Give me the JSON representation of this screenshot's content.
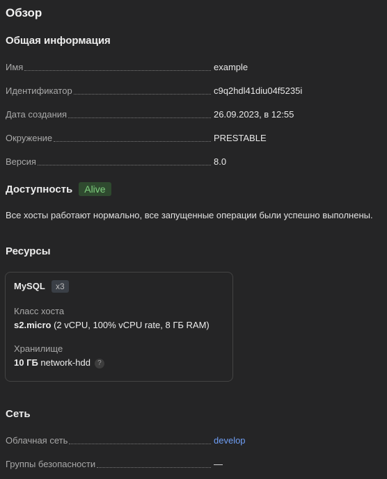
{
  "page": {
    "title": "Обзор"
  },
  "general": {
    "title": "Общая информация",
    "rows": [
      {
        "label": "Имя",
        "value": "example"
      },
      {
        "label": "Идентификатор",
        "value": "c9q2hdl41diu04f5235i"
      },
      {
        "label": "Дата создания",
        "value": "26.09.2023, в 12:55"
      },
      {
        "label": "Окружение",
        "value": "PRESTABLE"
      },
      {
        "label": "Версия",
        "value": "8.0"
      }
    ]
  },
  "availability": {
    "title": "Доступность",
    "status": "Alive",
    "status_color": "#7fd07f",
    "description": "Все хосты работают нормально, все запущенные операции были успешно выполнены."
  },
  "resources": {
    "title": "Ресурсы",
    "card": {
      "name": "MySQL",
      "count": "x3",
      "host_class_label": "Класс хоста",
      "host_class_value": "s2.micro",
      "host_class_detail": " (2 vCPU, 100% vCPU rate, 8 ГБ RAM)",
      "storage_label": "Хранилище",
      "storage_value": "10 ГБ",
      "storage_type": " network-hdd",
      "help_icon": "question-circle-icon",
      "help_glyph": "?"
    }
  },
  "network": {
    "title": "Сеть",
    "rows": [
      {
        "label": "Облачная сеть",
        "value": "develop",
        "link": true
      },
      {
        "label": "Группы безопасности",
        "value": "—"
      }
    ]
  }
}
